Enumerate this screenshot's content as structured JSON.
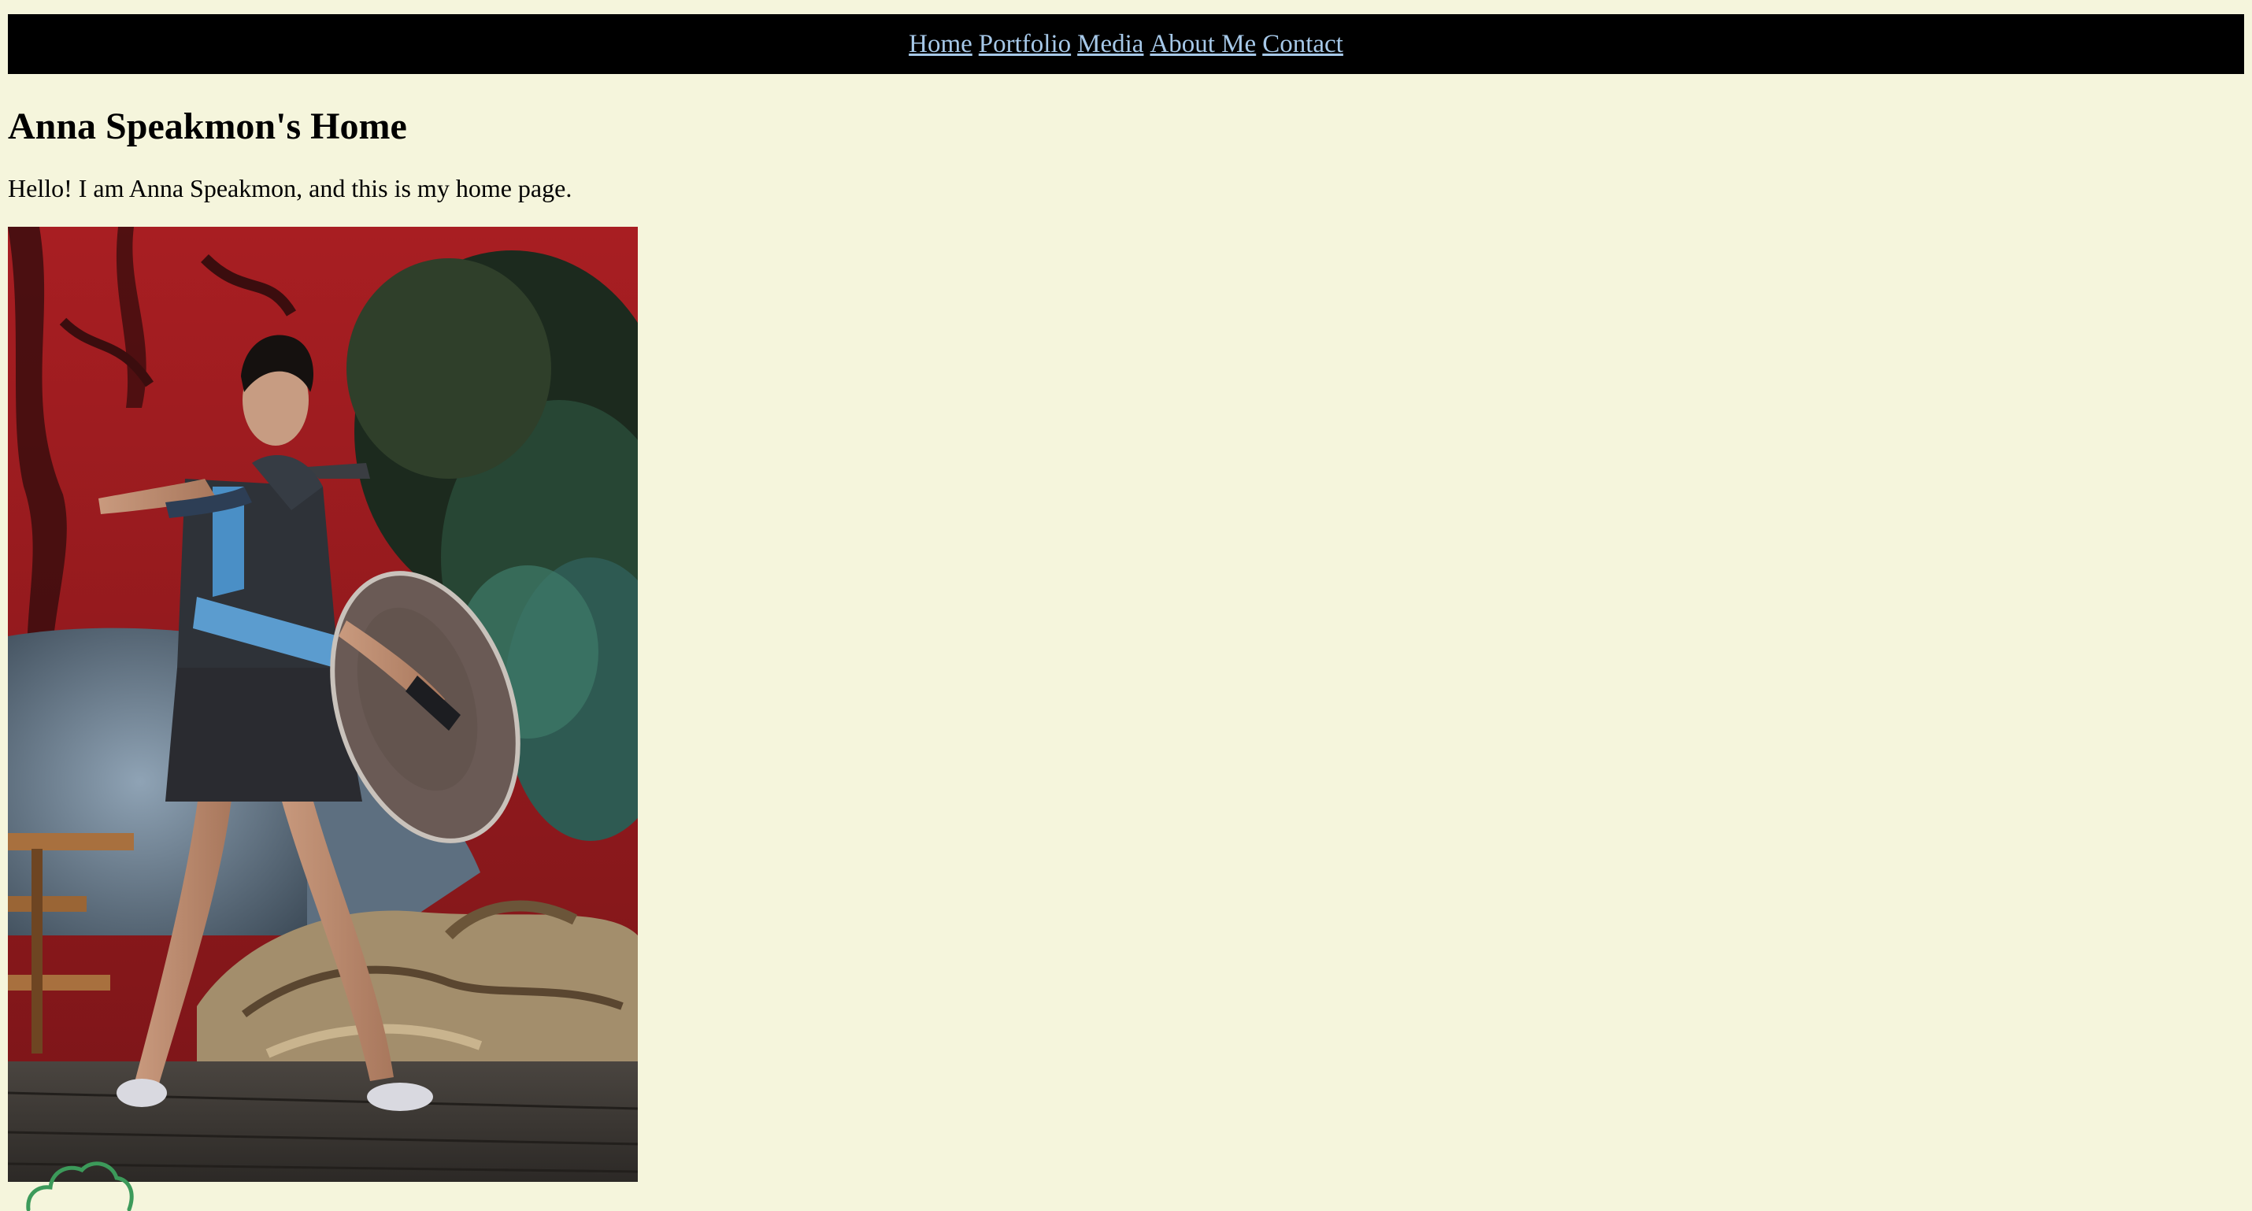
{
  "nav": {
    "items": [
      {
        "label": "Home"
      },
      {
        "label": "Portfolio"
      },
      {
        "label": "Media"
      },
      {
        "label": "About Me"
      },
      {
        "label": "Contact"
      }
    ]
  },
  "main": {
    "title": "Anna Speakmon's Home",
    "intro": "Hello! I am Anna Speakmon, and this is my home page."
  },
  "colors": {
    "background": "#f5f5dc",
    "nav_background": "#000000",
    "link": "#a6c8e8",
    "cloud_icon": "#3c9a5a"
  },
  "icons": {
    "photo": "stage-performer-photo",
    "corner": "cloud-icon"
  }
}
